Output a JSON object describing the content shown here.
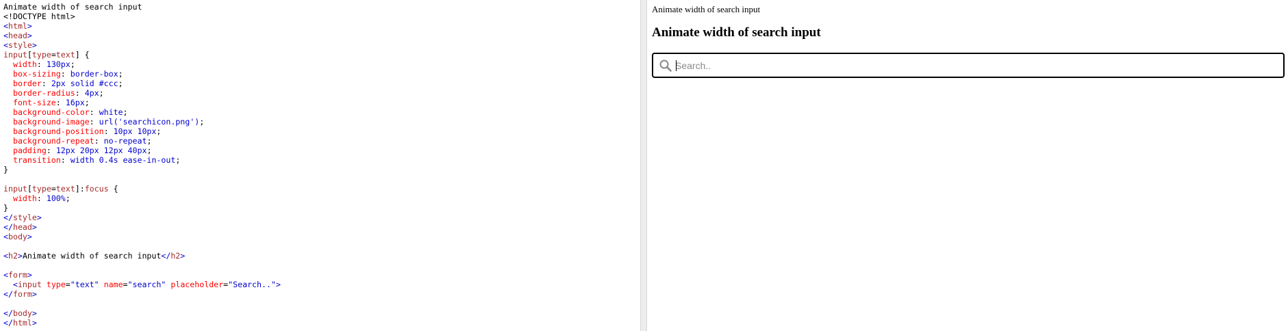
{
  "code": {
    "lines": [
      [
        [
          "plain",
          "Animate width of search input"
        ]
      ],
      [
        [
          "plain",
          "<!DOCTYPE html>"
        ]
      ],
      [
        [
          "br",
          "<"
        ],
        [
          "tag",
          "html"
        ],
        [
          "br",
          ">"
        ]
      ],
      [
        [
          "br",
          "<"
        ],
        [
          "tag",
          "head"
        ],
        [
          "br",
          ">"
        ]
      ],
      [
        [
          "br",
          "<"
        ],
        [
          "tag",
          "style"
        ],
        [
          "br",
          ">"
        ]
      ],
      [
        [
          "sel",
          "input"
        ],
        [
          "plain",
          "["
        ],
        [
          "sel",
          "type"
        ],
        [
          "plain",
          "="
        ],
        [
          "sel",
          "text"
        ],
        [
          "plain",
          "] {"
        ]
      ],
      [
        [
          "plain",
          "  "
        ],
        [
          "prop",
          "width"
        ],
        [
          "punct",
          ": "
        ],
        [
          "val",
          "130px"
        ],
        [
          "punct",
          ";"
        ]
      ],
      [
        [
          "plain",
          "  "
        ],
        [
          "prop",
          "box-sizing"
        ],
        [
          "punct",
          ": "
        ],
        [
          "val",
          "border-box"
        ],
        [
          "punct",
          ";"
        ]
      ],
      [
        [
          "plain",
          "  "
        ],
        [
          "prop",
          "border"
        ],
        [
          "punct",
          ": "
        ],
        [
          "val",
          "2px solid #ccc"
        ],
        [
          "punct",
          ";"
        ]
      ],
      [
        [
          "plain",
          "  "
        ],
        [
          "prop",
          "border-radius"
        ],
        [
          "punct",
          ": "
        ],
        [
          "val",
          "4px"
        ],
        [
          "punct",
          ";"
        ]
      ],
      [
        [
          "plain",
          "  "
        ],
        [
          "prop",
          "font-size"
        ],
        [
          "punct",
          ": "
        ],
        [
          "val",
          "16px"
        ],
        [
          "punct",
          ";"
        ]
      ],
      [
        [
          "plain",
          "  "
        ],
        [
          "prop",
          "background-color"
        ],
        [
          "punct",
          ": "
        ],
        [
          "val",
          "white"
        ],
        [
          "punct",
          ";"
        ]
      ],
      [
        [
          "plain",
          "  "
        ],
        [
          "prop",
          "background-image"
        ],
        [
          "punct",
          ": "
        ],
        [
          "val",
          "url('searchicon.png')"
        ],
        [
          "punct",
          ";"
        ]
      ],
      [
        [
          "plain",
          "  "
        ],
        [
          "prop",
          "background-position"
        ],
        [
          "punct",
          ": "
        ],
        [
          "val",
          "10px 10px"
        ],
        [
          "punct",
          ";"
        ]
      ],
      [
        [
          "plain",
          "  "
        ],
        [
          "prop",
          "background-repeat"
        ],
        [
          "punct",
          ": "
        ],
        [
          "val",
          "no-repeat"
        ],
        [
          "punct",
          ";"
        ]
      ],
      [
        [
          "plain",
          "  "
        ],
        [
          "prop",
          "padding"
        ],
        [
          "punct",
          ": "
        ],
        [
          "val",
          "12px 20px 12px 40px"
        ],
        [
          "punct",
          ";"
        ]
      ],
      [
        [
          "plain",
          "  "
        ],
        [
          "prop",
          "transition"
        ],
        [
          "punct",
          ": "
        ],
        [
          "val",
          "width 0.4s ease-in-out"
        ],
        [
          "punct",
          ";"
        ]
      ],
      [
        [
          "plain",
          "}"
        ]
      ],
      [
        [
          "plain",
          ""
        ]
      ],
      [
        [
          "sel",
          "input"
        ],
        [
          "plain",
          "["
        ],
        [
          "sel",
          "type"
        ],
        [
          "plain",
          "="
        ],
        [
          "sel",
          "text"
        ],
        [
          "plain",
          "]:"
        ],
        [
          "sel",
          "focus"
        ],
        [
          "plain",
          " {"
        ]
      ],
      [
        [
          "plain",
          "  "
        ],
        [
          "prop",
          "width"
        ],
        [
          "punct",
          ": "
        ],
        [
          "val",
          "100%"
        ],
        [
          "punct",
          ";"
        ]
      ],
      [
        [
          "plain",
          "}"
        ]
      ],
      [
        [
          "br",
          "</"
        ],
        [
          "tag",
          "style"
        ],
        [
          "br",
          ">"
        ]
      ],
      [
        [
          "br",
          "</"
        ],
        [
          "tag",
          "head"
        ],
        [
          "br",
          ">"
        ]
      ],
      [
        [
          "br",
          "<"
        ],
        [
          "tag",
          "body"
        ],
        [
          "br",
          ">"
        ]
      ],
      [
        [
          "plain",
          ""
        ]
      ],
      [
        [
          "br",
          "<"
        ],
        [
          "tag",
          "h2"
        ],
        [
          "br",
          ">"
        ],
        [
          "plain",
          "Animate width of search input"
        ],
        [
          "br",
          "</"
        ],
        [
          "tag",
          "h2"
        ],
        [
          "br",
          ">"
        ]
      ],
      [
        [
          "plain",
          ""
        ]
      ],
      [
        [
          "br",
          "<"
        ],
        [
          "tag",
          "form"
        ],
        [
          "br",
          ">"
        ]
      ],
      [
        [
          "plain",
          "  "
        ],
        [
          "br",
          "<"
        ],
        [
          "tag",
          "input"
        ],
        [
          "plain",
          " "
        ],
        [
          "attr",
          "type"
        ],
        [
          "plain",
          "="
        ],
        [
          "str",
          "\"text\""
        ],
        [
          "plain",
          " "
        ],
        [
          "attr",
          "name"
        ],
        [
          "plain",
          "="
        ],
        [
          "str",
          "\"search\""
        ],
        [
          "plain",
          " "
        ],
        [
          "attr",
          "placeholder"
        ],
        [
          "plain",
          "="
        ],
        [
          "str",
          "\"Search..\""
        ],
        [
          "br",
          ">"
        ]
      ],
      [
        [
          "br",
          "</"
        ],
        [
          "tag",
          "form"
        ],
        [
          "br",
          ">"
        ]
      ],
      [
        [
          "plain",
          ""
        ]
      ],
      [
        [
          "br",
          "</"
        ],
        [
          "tag",
          "body"
        ],
        [
          "br",
          ">"
        ]
      ],
      [
        [
          "br",
          "</"
        ],
        [
          "tag",
          "html"
        ],
        [
          "br",
          ">"
        ]
      ]
    ]
  },
  "result": {
    "title": "Animate width of search input",
    "heading": "Animate width of search input",
    "search": {
      "placeholder": "Search..",
      "value": ""
    }
  },
  "icons": {
    "search": "search-icon"
  },
  "colors": {
    "tag": "#a52a2a",
    "bracket": "#0000cd",
    "property": "#ff0000",
    "value": "#0000cd",
    "string": "#0000cd",
    "divider": "#ededed",
    "search_border": "#000000",
    "placeholder": "#8a8a8a"
  }
}
